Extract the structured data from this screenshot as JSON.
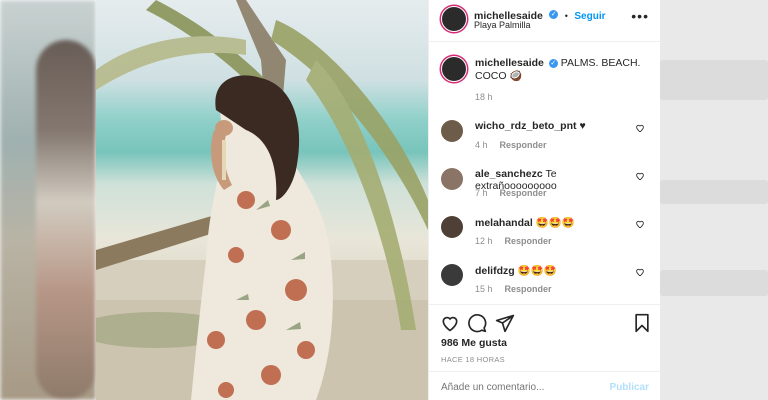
{
  "post": {
    "username": "michellesaide",
    "follow_label": "Seguir",
    "separator": "•",
    "location": "Playa Palmilla",
    "caption": "PALMS. BEACH. COCO 🥥",
    "caption_time": "18 h"
  },
  "comments": [
    {
      "user": "wicho_rdz_beto_pnt",
      "text": "♥",
      "time": "4 h",
      "reply": "Responder"
    },
    {
      "user": "ale_sanchezc",
      "text": "Te extrañooooooooo",
      "time": "7 h",
      "reply": "Responder"
    },
    {
      "user": "melahandal",
      "text": "🤩🤩🤩",
      "time": "12 h",
      "reply": "Responder"
    },
    {
      "user": "delifdzg",
      "text": "🤩🤩🤩",
      "time": "15 h",
      "reply": "Responder"
    }
  ],
  "footer": {
    "likes": "986 Me gusta",
    "posted_ago": "HACE 18 HORAS",
    "comment_placeholder": "Añade un comentario...",
    "publish_label": "Publicar"
  },
  "colors": {
    "link": "#0095f6",
    "verified": "#3897f0",
    "muted": "#8e8e8e"
  },
  "icons": [
    "more-options-icon",
    "verified-badge-icon",
    "heart-icon",
    "comment-icon",
    "share-icon",
    "save-icon"
  ]
}
